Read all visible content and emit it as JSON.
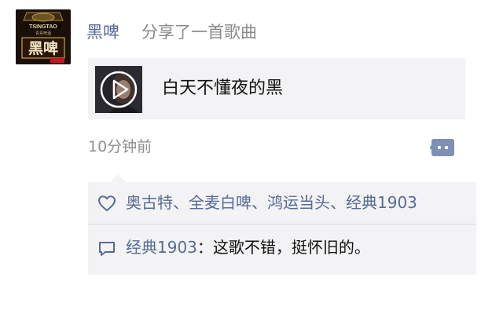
{
  "post": {
    "user_name": "黑啤",
    "action_text": "分享了一首歌曲",
    "avatar_label": "TSINGTAO 青岛啤酒 黑啤",
    "song": {
      "title": "白天不懂夜的黑",
      "cover_icon": "play-circle-icon"
    },
    "timestamp": "10分钟前",
    "comment_button_icon": "comment-dots-icon"
  },
  "likes": {
    "icon": "heart-outline-icon",
    "names_text": "奥古特、全麦白啤、鸿运当头、经典1903"
  },
  "comments": [
    {
      "author": "经典1903",
      "separator": "：",
      "text": "这歌不错，挺怀旧的。"
    }
  ],
  "colors": {
    "link_blue": "#576b95",
    "card_bg": "#f3f3f5",
    "muted_gray": "#8e8e8e"
  }
}
